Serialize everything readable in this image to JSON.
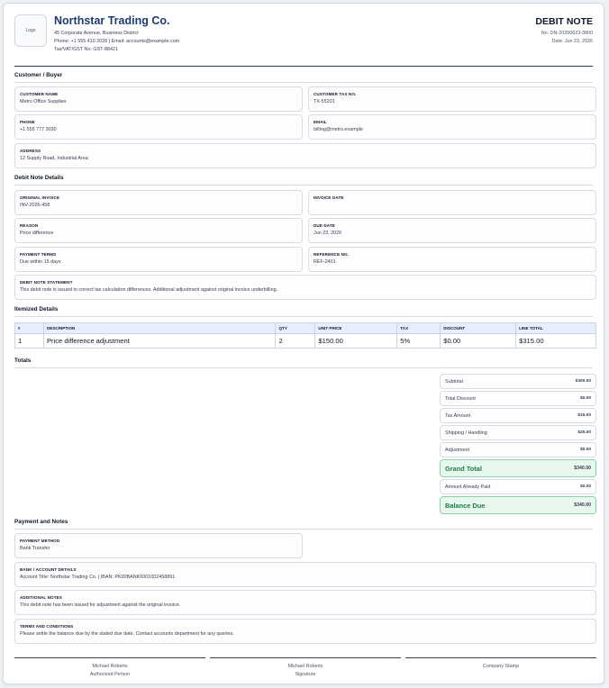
{
  "header": {
    "logo_text": "Logo",
    "company_name": "Northstar Trading Co.",
    "address": "45 Corporate Avenue, Business District",
    "contact": "Phone: +1 555 410 2026 | Email: accounts@example.com",
    "tax": "Tax/VAT/GST No: GST-88421",
    "doc_title": "DEBIT NOTE",
    "doc_no": "No. DN-20260623-3800",
    "doc_date": "Date: Jun 23, 2026"
  },
  "customer": {
    "section": "Customer / Buyer",
    "fields": [
      {
        "label": "CUSTOMER NAME",
        "value": "Metro Office Supplies"
      },
      {
        "label": "CUSTOMER TAX NO.",
        "value": "TX-55201"
      },
      {
        "label": "PHONE",
        "value": "+1 555 777 3030"
      },
      {
        "label": "EMAIL",
        "value": "billing@metro.example"
      },
      {
        "label": "ADDRESS",
        "value": "12 Supply Road, Industrial Area"
      }
    ]
  },
  "details": {
    "section": "Debit Note Details",
    "fields": [
      {
        "label": "ORIGINAL INVOICE",
        "value": "INV-2026-458"
      },
      {
        "label": "INVOICE DATE",
        "value": ""
      },
      {
        "label": "REASON",
        "value": "Price difference"
      },
      {
        "label": "DUE DATE",
        "value": "Jun 23, 2026"
      },
      {
        "label": "PAYMENT TERMS",
        "value": "Due within 15 days"
      },
      {
        "label": "REFERENCE NO.",
        "value": "REF-2401"
      },
      {
        "label": "DEBIT NOTE STATEMENT",
        "value": "This debit note is issued to correct tax calculation differences. Additional adjustment against original invoice underbilling."
      }
    ]
  },
  "items": {
    "section": "Itemized Details",
    "columns": [
      "#",
      "DESCRIPTION",
      "QTY",
      "UNIT PRICE",
      "TAX",
      "DISCOUNT",
      "LINE TOTAL"
    ],
    "rows": [
      [
        "1",
        "Price difference adjustment",
        "2",
        "$150.00",
        "5%",
        "$0.00",
        "$315.00"
      ]
    ]
  },
  "totals": {
    "section": "Totals",
    "rows": [
      {
        "label": "Subtotal",
        "value": "$300.00"
      },
      {
        "label": "Total Discount",
        "value": "$0.00"
      },
      {
        "label": "Tax Amount",
        "value": "$15.00"
      },
      {
        "label": "Shipping / Handling",
        "value": "$25.00"
      },
      {
        "label": "Adjustment",
        "value": "$0.00"
      },
      {
        "label": "Grand Total",
        "value": "$340.00"
      },
      {
        "label": "Amount Already Paid",
        "value": "$0.00"
      },
      {
        "label": "Balance Due",
        "value": "$340.00"
      }
    ]
  },
  "payment": {
    "section": "Payment and Notes",
    "fields": [
      {
        "label": "PAYMENT METHOD",
        "value": "Bank Transfer"
      },
      {
        "label": "BANK / ACCOUNT DETAILS",
        "value": "Account Title: Northstar Trading Co. | IBAN: PK00BANK0001002458891"
      },
      {
        "label": "ADDITIONAL NOTES",
        "value": "This debit note has been issued for adjustment against the original invoice."
      },
      {
        "label": "TERMS AND CONDITIONS",
        "value": "Please settle the balance due by the stated due date. Contact accounts department for any queries."
      }
    ]
  },
  "signatures": [
    {
      "name": "Michael Roberts",
      "role": "Authorized Person"
    },
    {
      "name": "Michael Roberts",
      "role": "Signature"
    },
    {
      "name": "",
      "role": "Company Stamp"
    }
  ],
  "colors": {
    "brand": "#1e3a6e",
    "success": "#1f7a46",
    "success_bg": "#e8f8ee"
  }
}
